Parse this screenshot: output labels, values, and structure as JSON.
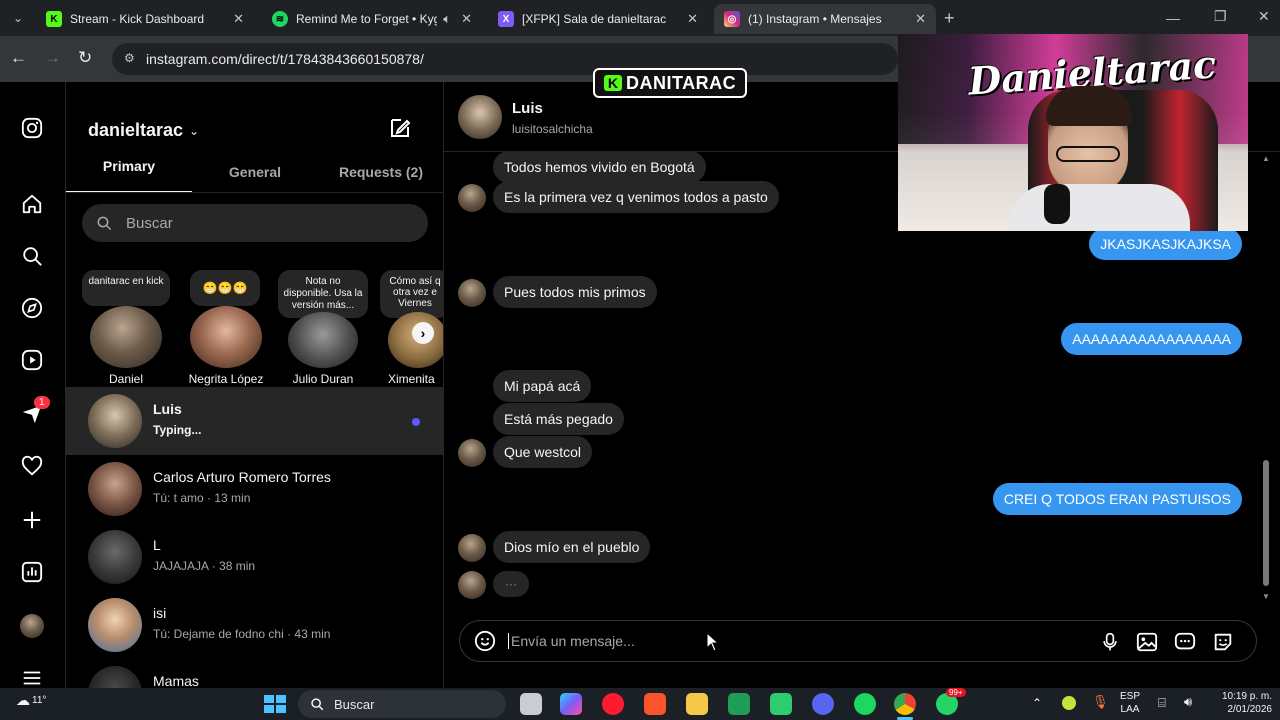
{
  "browser": {
    "tabs": [
      {
        "title": "Stream - Kick Dashboard",
        "color": "#53fc18",
        "glyph": "K"
      },
      {
        "title": "Remind Me to Forget • Kyg",
        "color": "#1ed760",
        "glyph": "≋"
      },
      {
        "title": "[XFPK] Sala de danieltarac",
        "color": "#7b5cf5",
        "glyph": "X"
      },
      {
        "title": "(1) Instagram • Mensajes",
        "color": "#e1306c",
        "glyph": "◎"
      }
    ],
    "url": "instagram.com/direct/t/17843843660150878/",
    "new_tab": "+"
  },
  "overlay": {
    "logo_text": "DANITARAC",
    "logo_glyph": "K",
    "webcam_sign": "Danieltarac"
  },
  "nav": {
    "notification_count": "1"
  },
  "inbox": {
    "username": "danieltarac",
    "tabs": [
      "Primary",
      "General",
      "Requests (2)"
    ],
    "search_placeholder": "Buscar",
    "notes": [
      {
        "note": "danitarac en kick",
        "name": "Daniel"
      },
      {
        "note": "😁😁😁",
        "name": "Negrita López"
      },
      {
        "note": "Nota no disponible. Usa la versión más...",
        "name": "Julio Duran"
      },
      {
        "note": "Cómo así q otra vez e Viernes",
        "name": "Ximenita"
      }
    ],
    "threads": [
      {
        "name": "Luis",
        "preview": "Typing...",
        "active": true
      },
      {
        "name": "Carlos Arturo Romero Torres",
        "preview": "Tú: t amo · 13 min"
      },
      {
        "name": "L",
        "preview": "JAJAJAJA · 38 min"
      },
      {
        "name": "isi",
        "preview": "Tú: Dejame de fodno chi · 43 min"
      },
      {
        "name": "Mamas",
        "preview": ""
      }
    ]
  },
  "conversation": {
    "name": "Luis",
    "handle": "luisitosalchicha",
    "messages_in": [
      "Todos hemos vivido en Bogotá",
      "Es la primera vez q venimos todos a pasto",
      "Pues todos mis primos",
      "Mi papá acá",
      "Está más pegado",
      "Que westcol",
      "Dios mío en el pueblo"
    ],
    "messages_out": [
      "JKASJKASJKAJKSA",
      "AAAAAAAAAAAAAAAAA",
      "CREI Q TODOS ERAN PASTUISOS"
    ],
    "typing": "···",
    "input_placeholder": "Envía un mensaje..."
  },
  "taskbar": {
    "weather": "11°",
    "search": "Buscar",
    "lang": "ESP",
    "lang2": "LAA",
    "time": "10:19 p. m.",
    "date": "2/01/2026",
    "whatsapp_badge": "99+"
  }
}
